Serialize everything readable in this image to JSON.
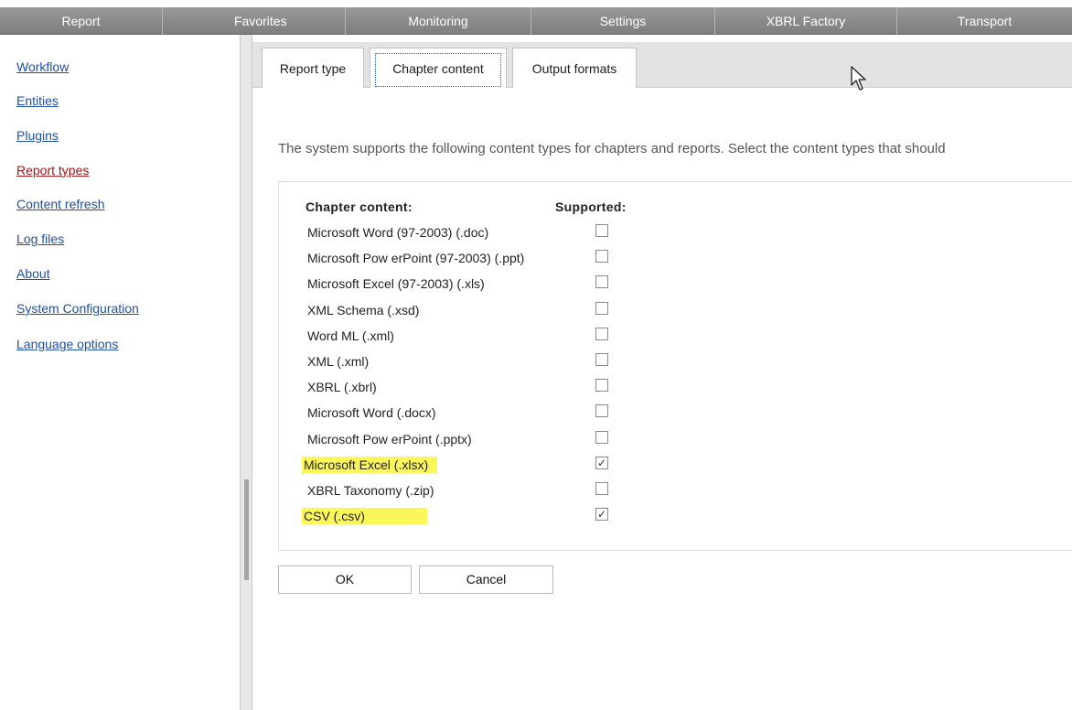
{
  "menu": {
    "items": [
      "Report",
      "Favorites",
      "Monitoring",
      "Settings",
      "XBRL Factory",
      "Transport"
    ]
  },
  "sidebar": {
    "items": [
      {
        "label": "Workflow",
        "active": false
      },
      {
        "label": "Entities",
        "active": false
      },
      {
        "label": "Plugins",
        "active": false
      },
      {
        "label": "Report types",
        "active": true
      },
      {
        "label": "Content refresh",
        "active": false
      },
      {
        "label": "Log files",
        "active": false
      },
      {
        "label": "About",
        "active": false
      },
      {
        "label": "System Configuration",
        "active": false
      },
      {
        "label": "Language options",
        "active": false
      }
    ]
  },
  "tabs": {
    "items": [
      "Report type",
      "Chapter content",
      "Output formats"
    ],
    "selected": "Chapter content"
  },
  "main": {
    "intro": "The system supports the following content types for chapters and reports. Select the content types that should",
    "column_content": "Chapter content:",
    "column_supported": "Supported:",
    "rows": [
      {
        "label": "Microsoft Word (97-2003) (.doc)",
        "checked": false,
        "highlighted": false
      },
      {
        "label": "Microsoft Pow erPoint (97-2003) (.ppt)",
        "checked": false,
        "highlighted": false
      },
      {
        "label": "Microsoft Excel (97-2003) (.xls)",
        "checked": false,
        "highlighted": false
      },
      {
        "label": "XML Schema (.xsd)",
        "checked": false,
        "highlighted": false
      },
      {
        "label": "Word ML (.xml)",
        "checked": false,
        "highlighted": false
      },
      {
        "label": "XML (.xml)",
        "checked": false,
        "highlighted": false
      },
      {
        "label": "XBRL (.xbrl)",
        "checked": false,
        "highlighted": false
      },
      {
        "label": "Microsoft Word (.docx)",
        "checked": false,
        "highlighted": false
      },
      {
        "label": "Microsoft Pow erPoint (.pptx)",
        "checked": false,
        "highlighted": false
      },
      {
        "label": "Microsoft Excel (.xlsx)",
        "checked": true,
        "highlighted": true
      },
      {
        "label": "XBRL Taxonomy (.zip)",
        "checked": false,
        "highlighted": false
      },
      {
        "label": "CSV (.csv)",
        "checked": true,
        "highlighted": true
      }
    ],
    "check_mark": "✓"
  },
  "buttons": {
    "ok": "OK",
    "cancel": "Cancel"
  },
  "icons": {
    "cursor": "mouse-pointer-icon"
  },
  "colors": {
    "menu_bar": "#8a8a8a",
    "link": "#1f4fa8",
    "active_link": "#a01616",
    "highlight": "#fbf65a"
  }
}
